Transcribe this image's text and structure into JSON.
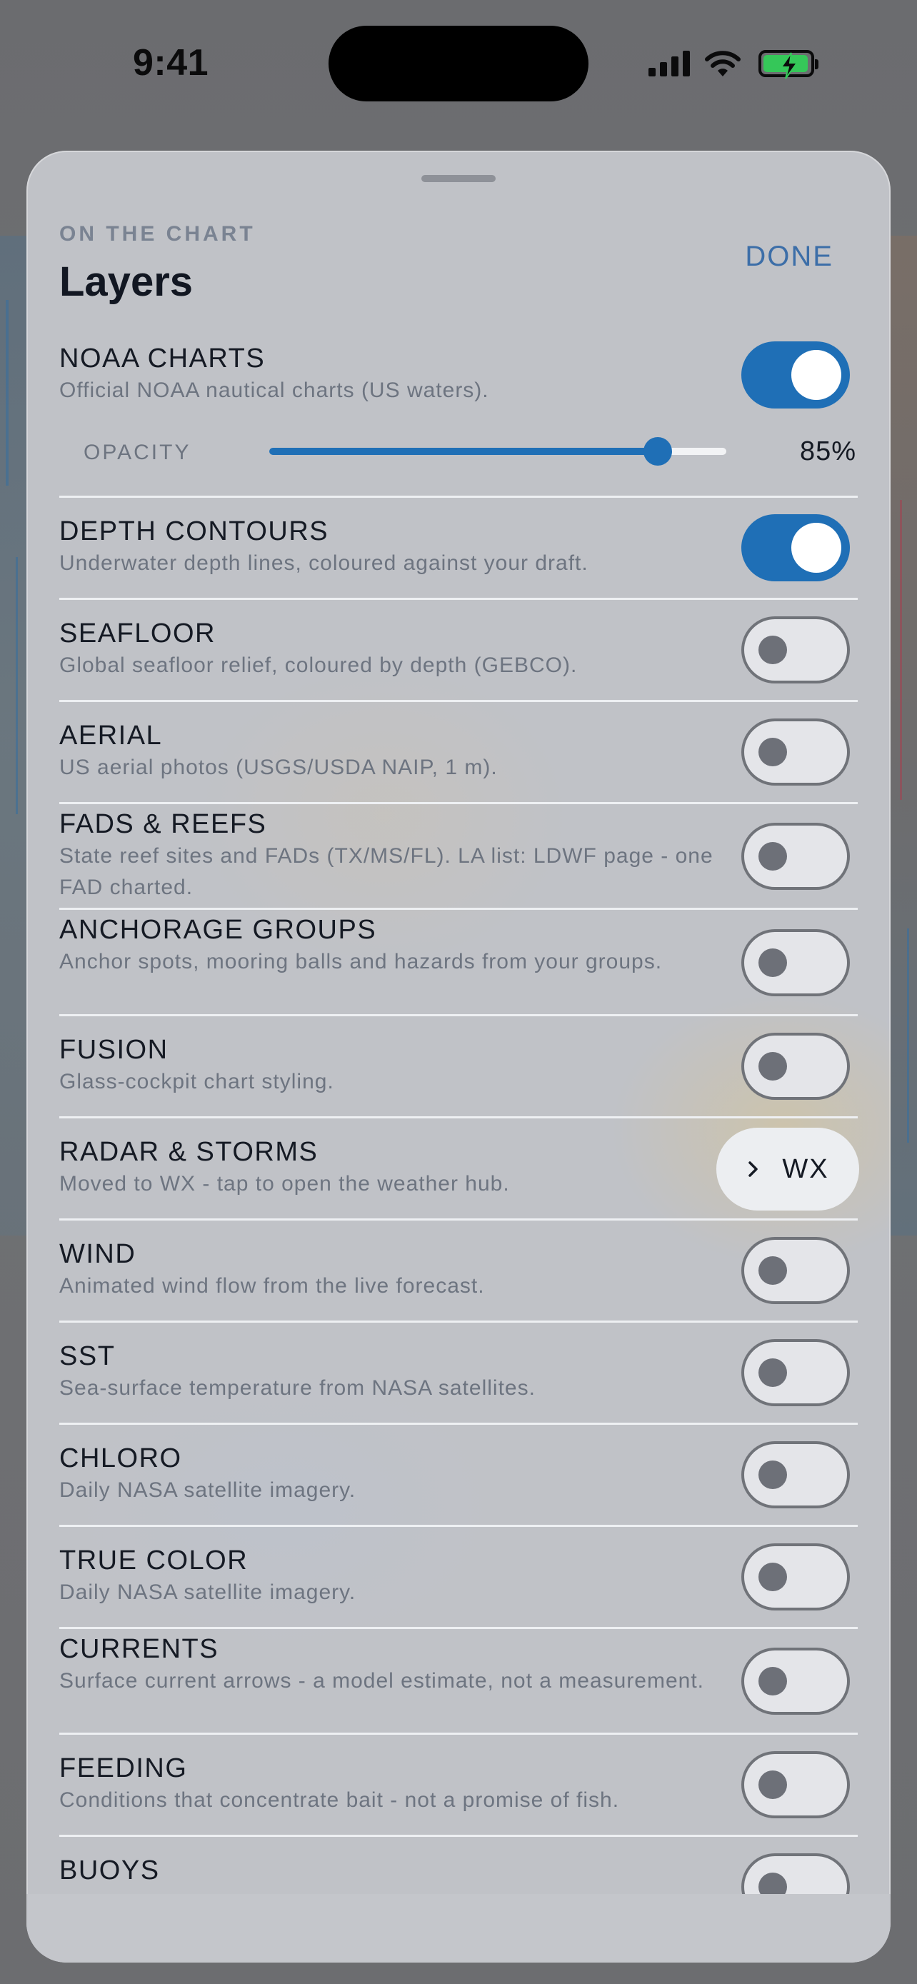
{
  "status_bar": {
    "time": "9:41"
  },
  "sheet": {
    "eyebrow": "ON THE CHART",
    "title": "Layers",
    "done_label": "DONE"
  },
  "layers": [
    {
      "title": "NOAA CHARTS",
      "desc": "Official NOAA nautical charts (US waters).",
      "enabled": true
    },
    {
      "title": "DEPTH CONTOURS",
      "desc": "Underwater depth lines, coloured against your draft.",
      "enabled": true
    },
    {
      "title": "SEAFLOOR",
      "desc": "Global seafloor relief, coloured by depth (GEBCO).",
      "enabled": false
    },
    {
      "title": "AERIAL",
      "desc": "US aerial photos (USGS/USDA NAIP, 1 m).",
      "enabled": false
    },
    {
      "title": "FADS & REEFS",
      "desc": "State reef sites and FADs (TX/MS/FL). LA list: LDWF page - one FAD charted.",
      "enabled": false
    },
    {
      "title": "ANCHORAGE GROUPS",
      "desc": "Anchor spots, mooring balls and hazards from your groups.",
      "enabled": false
    },
    {
      "title": "FUSION",
      "desc": "Glass-cockpit chart styling.",
      "enabled": false
    },
    {
      "title": "RADAR & STORMS",
      "desc": "Moved to WX - tap to open the weather hub.",
      "action_label": "WX"
    },
    {
      "title": "WIND",
      "desc": "Animated wind flow from the live forecast.",
      "enabled": false
    },
    {
      "title": "SST",
      "desc": "Sea-surface temperature from NASA satellites.",
      "enabled": false
    },
    {
      "title": "CHLORO",
      "desc": "Daily NASA satellite imagery.",
      "enabled": false
    },
    {
      "title": "TRUE COLOR",
      "desc": "Daily NASA satellite imagery.",
      "enabled": false
    },
    {
      "title": "CURRENTS",
      "desc": "Surface current arrows - a model estimate, not a measurement.",
      "enabled": false
    },
    {
      "title": "FEEDING",
      "desc": "Conditions that concentrate bait - not a promise of fish.",
      "enabled": false
    },
    {
      "title": "BUOYS",
      "enabled": false
    }
  ],
  "opacity": {
    "label": "OPACITY",
    "value": 0.85,
    "value_text": "85%"
  },
  "colors": {
    "accent": "#1f6fb6",
    "done": "#3c6ea8",
    "battery": "#35c759"
  },
  "icons": [
    "cellular-signal-icon",
    "wifi-icon",
    "battery-charging-icon",
    "chevron-right-icon"
  ]
}
